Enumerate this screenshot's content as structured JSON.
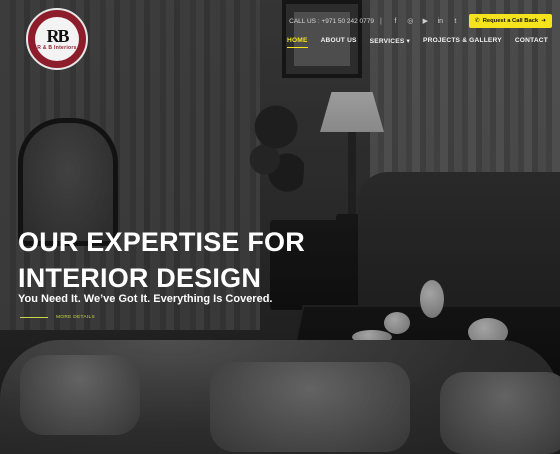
{
  "brand": {
    "monogram": "RB",
    "name": "R & B Interiors",
    "arabic_text": "ر & ب للتصميم الداخلي"
  },
  "topbar": {
    "contact": "CALL US : +971 50 242 0779",
    "separator": "|",
    "social_icons": [
      "facebook-icon",
      "instagram-icon",
      "youtube-icon",
      "linkedin-icon",
      "twitter-icon"
    ],
    "callback_label": "Request a Call Back"
  },
  "nav": {
    "items": [
      {
        "label": "HOME",
        "active": true
      },
      {
        "label": "ABOUT US",
        "active": false
      },
      {
        "label": "SERVICES ▾",
        "active": false
      },
      {
        "label": "PROJECTS & GALLERY",
        "active": false
      },
      {
        "label": "CONTACT",
        "active": false
      }
    ]
  },
  "hero": {
    "headline_line1": "OUR EXPERTISE FOR",
    "headline_line2": "INTERIOR DESIGN",
    "subline": "You Need It. We’ve Got It. Everything Is Covered.",
    "more_label": "MORE DETAILS"
  },
  "colors": {
    "accent": "#f5e41b",
    "brand": "#8d1d2b",
    "more_link": "#c9d84a"
  }
}
